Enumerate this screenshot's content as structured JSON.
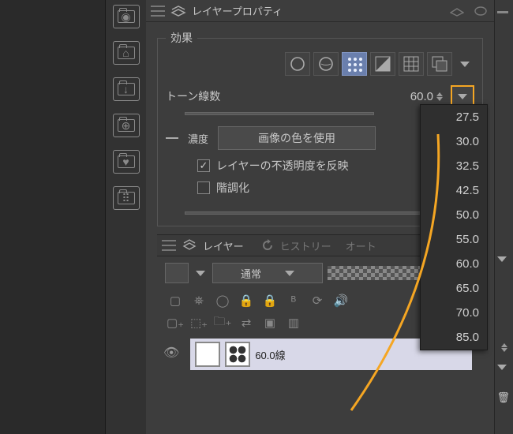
{
  "panel": {
    "title": "レイヤープロパティ"
  },
  "effects": {
    "legend": "効果",
    "tone_lines_label": "トーン線数",
    "tone_lines_value": "60.0",
    "density_label": "濃度",
    "use_image_color": "画像の色を使用",
    "reflect_opacity": "レイヤーの不透明度を反映",
    "posterize": "階調化"
  },
  "dropdown_values": [
    "27.5",
    "30.0",
    "32.5",
    "42.5",
    "50.0",
    "55.0",
    "60.0",
    "65.0",
    "70.0",
    "85.0"
  ],
  "layers": {
    "tab_layer": "レイヤー",
    "tab_history": "ヒストリー",
    "tab_auto": "オート",
    "blend_mode": "通常",
    "item_name": "60.0線"
  }
}
